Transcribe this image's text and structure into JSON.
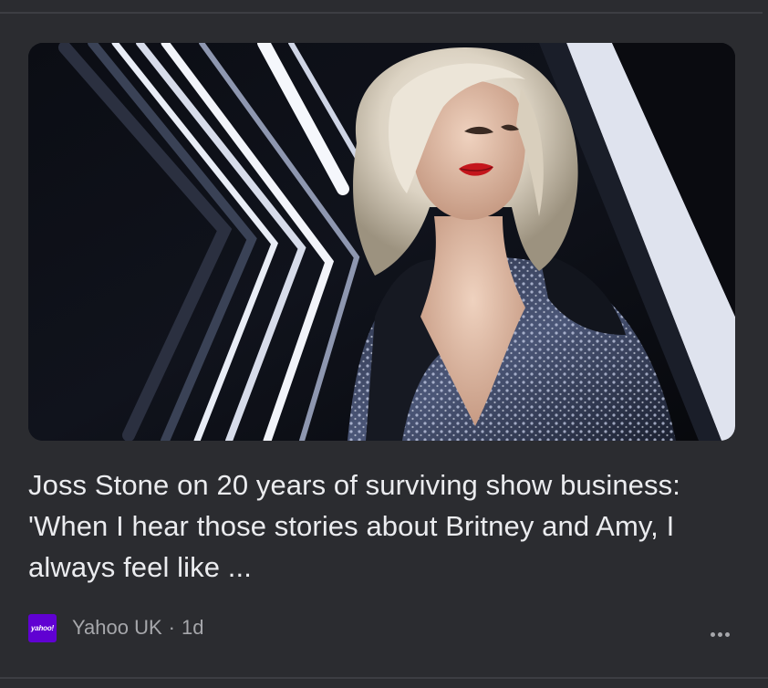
{
  "feed_item": {
    "image_alt": "Joss Stone",
    "headline": "Joss Stone on 20 years of surviving show business: 'When I hear those stories about Britney and Amy, I always feel like ...",
    "source_logo_text": "yahoo!",
    "source": "Yahoo UK",
    "separator": "·",
    "age": "1d",
    "more_icon": "more-horizontal-icon"
  },
  "colors": {
    "background": "#2b2c30",
    "headline": "#ebecef",
    "meta": "#a6a7ab",
    "yahoo_brand": "#6001d2"
  }
}
